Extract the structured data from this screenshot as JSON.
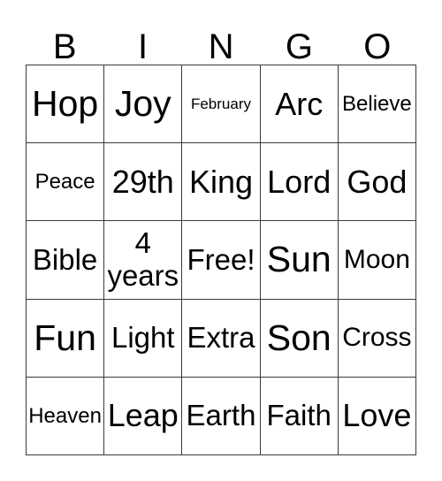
{
  "card": {
    "header_letters": [
      "B",
      "I",
      "N",
      "G",
      "O"
    ],
    "columns": 5,
    "rows": 5,
    "border_color": "#3a3a3a",
    "background_color": "#ffffff",
    "text_color": "#000000",
    "cells": [
      [
        {
          "text": "Hop",
          "size": "fs-xl"
        },
        {
          "text": "Joy",
          "size": "fs-xl"
        },
        {
          "text": "February",
          "size": "fs-xxs"
        },
        {
          "text": "Arc",
          "size": "fs-lg"
        },
        {
          "text": "Believe",
          "size": "fs-xs"
        }
      ],
      [
        {
          "text": "Peace",
          "size": "fs-xs"
        },
        {
          "text": "29th",
          "size": "fs-lg"
        },
        {
          "text": "King",
          "size": "fs-lg"
        },
        {
          "text": "Lord",
          "size": "fs-lg"
        },
        {
          "text": "God",
          "size": "fs-lg"
        }
      ],
      [
        {
          "text": "Bible",
          "size": "fs-md"
        },
        {
          "text": "4\nyears",
          "size": "two-line"
        },
        {
          "text": "Free!",
          "size": "fs-md"
        },
        {
          "text": "Sun",
          "size": "fs-xl"
        },
        {
          "text": "Moon",
          "size": "fs-sm"
        }
      ],
      [
        {
          "text": "Fun",
          "size": "fs-xl"
        },
        {
          "text": "Light",
          "size": "fs-md"
        },
        {
          "text": "Extra",
          "size": "fs-md"
        },
        {
          "text": "Son",
          "size": "fs-xl"
        },
        {
          "text": "Cross",
          "size": "fs-sm"
        }
      ],
      [
        {
          "text": "Heaven",
          "size": "fs-xs"
        },
        {
          "text": "Leap",
          "size": "fs-lg"
        },
        {
          "text": "Earth",
          "size": "fs-md"
        },
        {
          "text": "Faith",
          "size": "fs-md"
        },
        {
          "text": "Love",
          "size": "fs-lg"
        }
      ]
    ]
  }
}
